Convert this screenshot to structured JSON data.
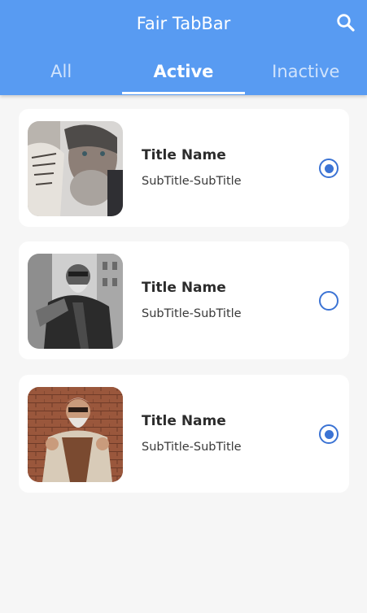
{
  "app_bar": {
    "title": "Fair TabBar",
    "background_color": "#589bf2",
    "search_icon": "search-icon"
  },
  "tabs": [
    {
      "label": "All",
      "selected": false
    },
    {
      "label": "Active",
      "selected": true
    },
    {
      "label": "Inactive",
      "selected": false
    }
  ],
  "items": [
    {
      "title": "Title Name",
      "subtitle": "SubTitle-SubTitle",
      "image": "portrait photo of man with beard, tattooed hand",
      "selected": true
    },
    {
      "title": "Title Name",
      "subtitle": "SubTitle-SubTitle",
      "image": "black and white photo of bearded man in leather jacket",
      "selected": false
    },
    {
      "title": "Title Name",
      "subtitle": "SubTitle-SubTitle",
      "image": "photo of bearded man with sunglasses against brick wall",
      "selected": true
    }
  ],
  "radio_color": "#3b73d4"
}
